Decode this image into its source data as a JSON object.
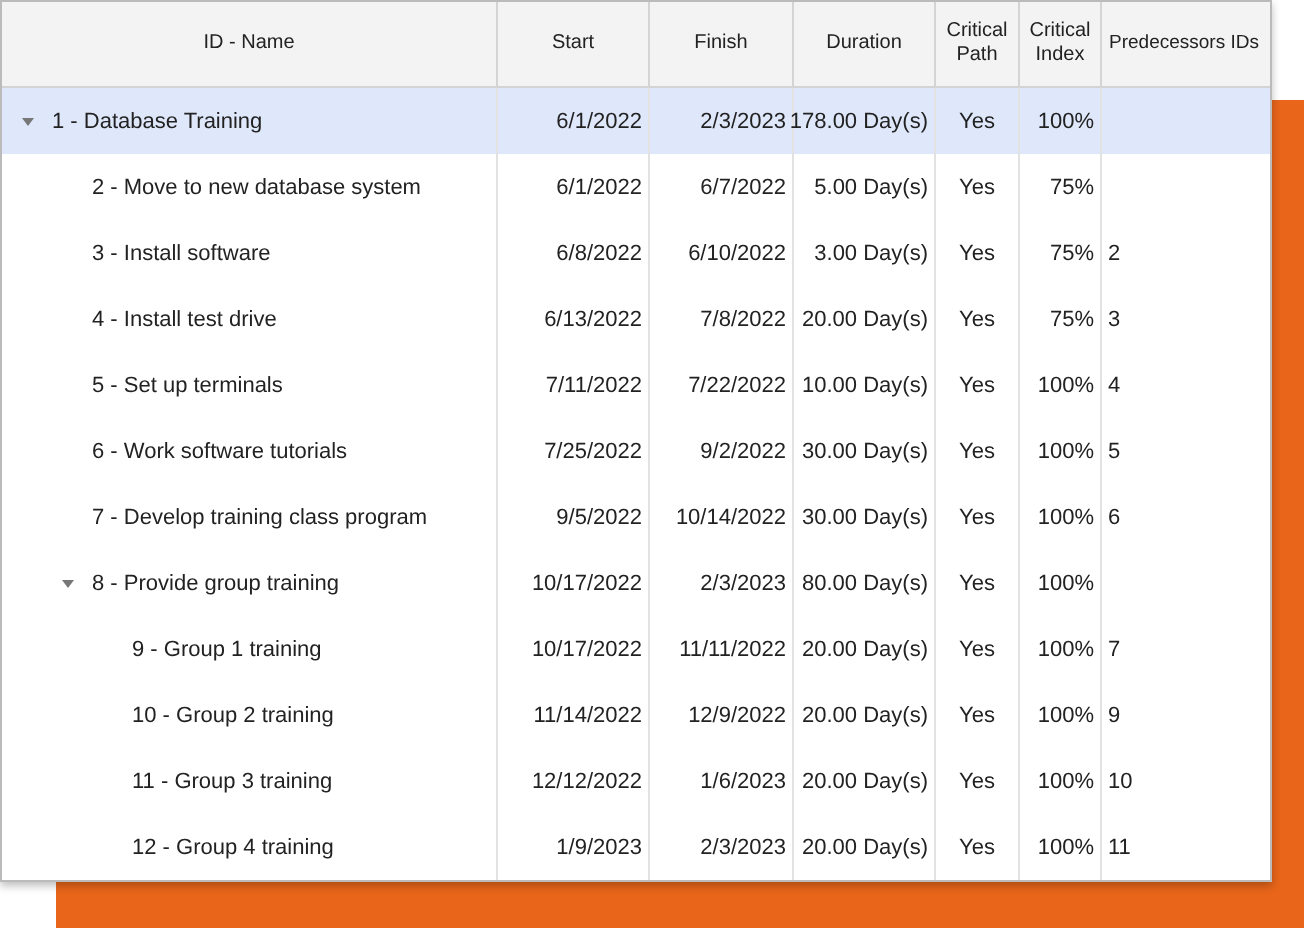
{
  "table": {
    "columns": [
      "ID - Name",
      "Start",
      "Finish",
      "Duration",
      "Critical Path",
      "Critical Index",
      "Predecessors IDs"
    ],
    "rows": [
      {
        "name": "1 - Database Training",
        "start": "6/1/2022",
        "finish": "2/3/2023",
        "duration": "178.00 Day(s)",
        "critical_path": "Yes",
        "critical_index": "100%",
        "selected": true,
        "expanded": true,
        "children": [
          {
            "name": "2 - Move to new database system",
            "start": "6/1/2022",
            "finish": "6/7/2022",
            "duration": "5.00 Day(s)",
            "critical_path": "Yes",
            "critical_index": "75%",
            "selected": false
          },
          {
            "name": "3 - Install software",
            "start": "6/8/2022",
            "finish": "6/10/2022",
            "duration": "3.00 Day(s)",
            "critical_path": "Yes",
            "critical_index": "75%",
            "predecessors": "2",
            "selected": false
          },
          {
            "name": "4 - Install test drive",
            "start": "6/13/2022",
            "finish": "7/8/2022",
            "duration": "20.00 Day(s)",
            "critical_path": "Yes",
            "critical_index": "75%",
            "predecessors": "3",
            "selected": false
          },
          {
            "name": "5 - Set up terminals",
            "start": "7/11/2022",
            "finish": "7/22/2022",
            "duration": "10.00 Day(s)",
            "critical_path": "Yes",
            "critical_index": "100%",
            "predecessors": "4",
            "selected": false
          },
          {
            "name": "6 - Work software tutorials",
            "start": "7/25/2022",
            "finish": "9/2/2022",
            "duration": "30.00 Day(s)",
            "critical_path": "Yes",
            "critical_index": "100%",
            "predecessors": "5",
            "selected": false
          },
          {
            "name": "7 - Develop training class program",
            "start": "9/5/2022",
            "finish": "10/14/2022",
            "duration": "30.00 Day(s)",
            "critical_path": "Yes",
            "critical_index": "100%",
            "predecessors": "6",
            "selected": false
          },
          {
            "name": "8 - Provide group training",
            "start": "10/17/2022",
            "finish": "2/3/2023",
            "duration": "80.00 Day(s)",
            "critical_path": "Yes",
            "critical_index": "100%",
            "selected": false,
            "expanded": true,
            "children": [
              {
                "name": "9 - Group 1 training",
                "start": "10/17/2022",
                "finish": "11/11/2022",
                "duration": "20.00 Day(s)",
                "critical_path": "Yes",
                "critical_index": "100%",
                "predecessors": "7",
                "selected": false
              },
              {
                "name": "10 - Group 2 training",
                "start": "11/14/2022",
                "finish": "12/9/2022",
                "duration": "20.00 Day(s)",
                "critical_path": "Yes",
                "critical_index": "100%",
                "predecessors": "9",
                "selected": false
              },
              {
                "name": "11 - Group 3 training",
                "start": "12/12/2022",
                "finish": "1/6/2023",
                "duration": "20.00 Day(s)",
                "critical_path": "Yes",
                "critical_index": "100%",
                "predecessors": "10",
                "selected": false
              },
              {
                "name": "12 - Group 4 training",
                "start": "1/9/2023",
                "finish": "2/3/2023",
                "duration": "20.00 Day(s)",
                "critical_path": "Yes",
                "critical_index": "100%",
                "predecessors": "11",
                "selected": false
              }
            ]
          }
        ]
      }
    ]
  }
}
